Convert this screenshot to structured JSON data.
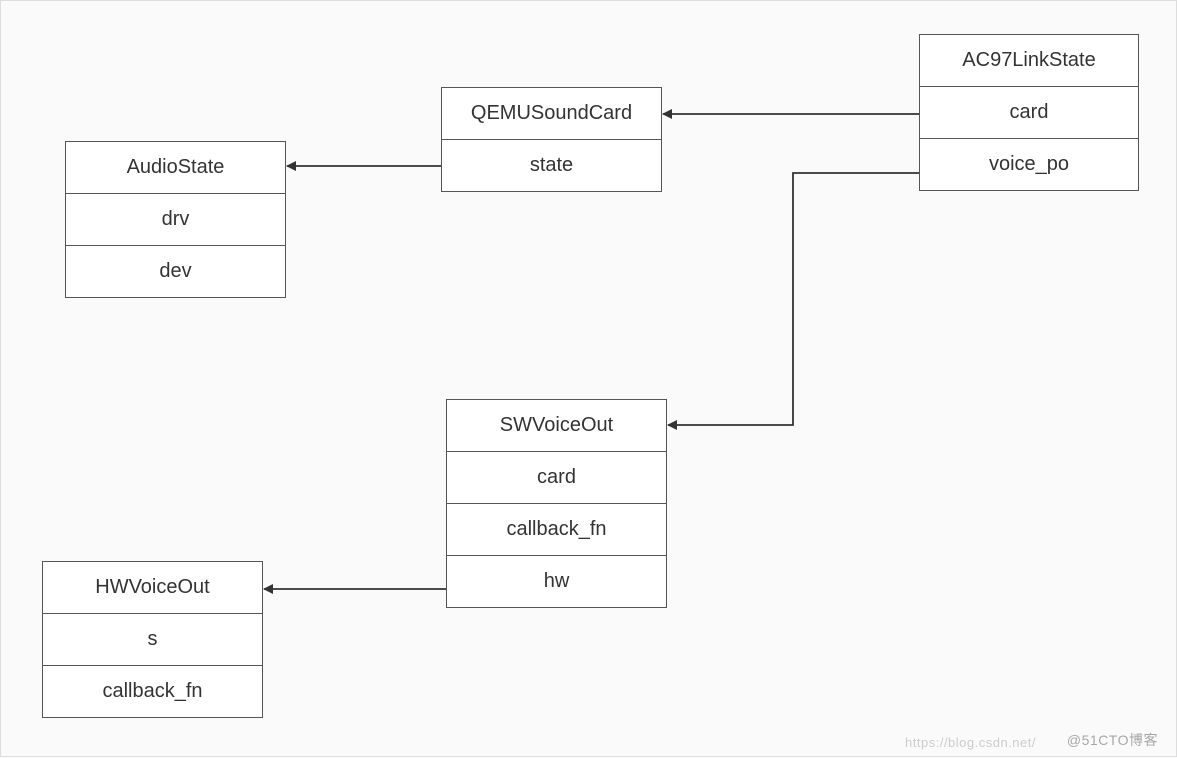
{
  "boxes": {
    "audiostate": {
      "title": "AudioState",
      "fields": [
        "drv",
        "dev"
      ]
    },
    "qemusoundcard": {
      "title": "QEMUSoundCard",
      "fields": [
        "state"
      ]
    },
    "ac97": {
      "title": "AC97LinkState",
      "fields": [
        "card",
        "voice_po"
      ]
    },
    "swvoiceout": {
      "title": "SWVoiceOut",
      "fields": [
        "card",
        "callback_fn",
        "hw"
      ]
    },
    "hwvoiceout": {
      "title": "HWVoiceOut",
      "fields": [
        "s",
        "callback_fn"
      ]
    }
  },
  "watermark": "@51CTO博客",
  "watermark2": "https://blog.csdn.net/"
}
